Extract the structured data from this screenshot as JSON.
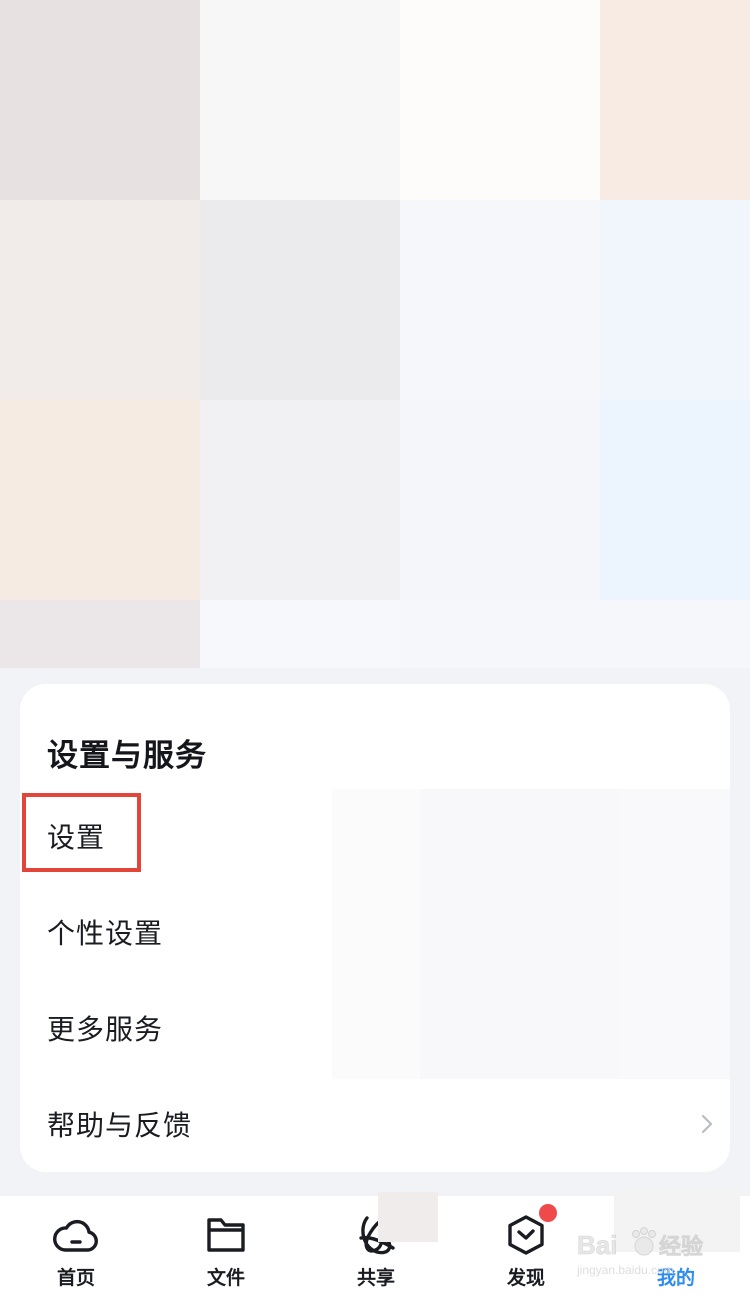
{
  "colors": {
    "accent": "#2c8cf0",
    "highlight": "#e2453a",
    "badge": "#f0494a",
    "page_background": "#f2f3f7"
  },
  "settings_card": {
    "title": "设置与服务",
    "items": [
      {
        "label": "设置",
        "highlighted": true
      },
      {
        "label": "个性设置"
      },
      {
        "label": "更多服务"
      },
      {
        "label": "帮助与反馈",
        "chevron": "chevron-right-icon"
      }
    ]
  },
  "tabbar": {
    "tabs": [
      {
        "label": "首页",
        "icon": "cloud-icon"
      },
      {
        "label": "文件",
        "icon": "folder-icon"
      },
      {
        "label": "共享",
        "icon": "share-orbit-icon"
      },
      {
        "label": "发现",
        "icon": "discover-box-icon",
        "badge": true
      },
      {
        "label": "我的",
        "icon": "profile-icon",
        "active": true
      }
    ]
  },
  "watermark": {
    "line1": "Bai",
    "line2": "经验",
    "line3": "jingyan.baidu.com"
  }
}
